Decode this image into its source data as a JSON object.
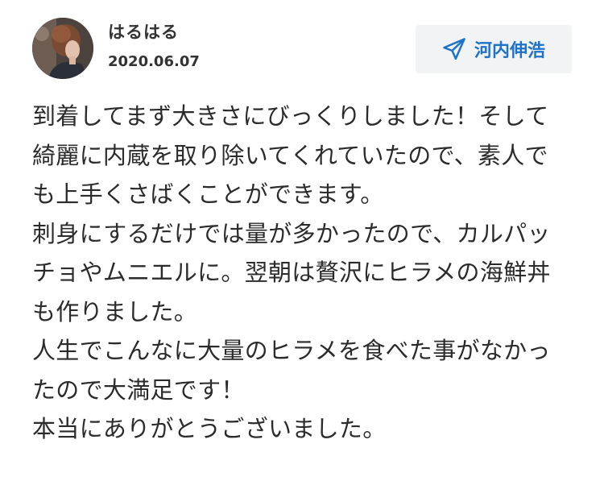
{
  "review": {
    "user_name": "はるはる",
    "date": "2020.06.07",
    "recipient": "河内伸浩",
    "icons": {
      "avatar": "user-photo-avatar",
      "send": "paper-plane-icon"
    },
    "colors": {
      "accent": "#1e73c8",
      "button_bg": "#f2f3f5",
      "text": "#2b2b2b"
    },
    "body_lines": [
      "到着してまず大きさにびっくりしました！そして",
      "綺麗に内蔵を取り除いてくれていたので、素人で",
      "も上手くさばくことができます。",
      "刺身にするだけでは量が多かったので、カルパッ",
      "チョやムニエルに。翌朝は贅沢にヒラメの海鮮丼",
      "も作りました。",
      "人生でこんなに大量のヒラメを食べた事がなかっ",
      "たので大満足です！",
      "本当にありがとうございました。"
    ]
  }
}
